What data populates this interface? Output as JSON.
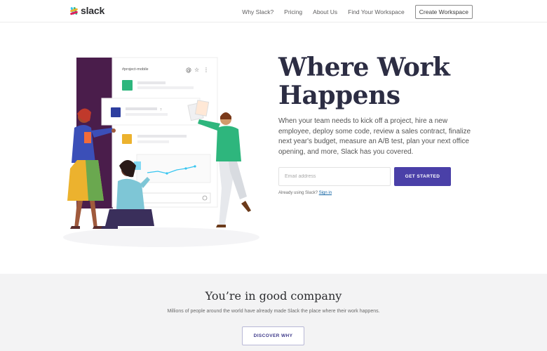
{
  "header": {
    "brand": "slack",
    "nav": [
      "Why Slack?",
      "Pricing",
      "About Us",
      "Find Your Workspace"
    ],
    "cta": "Create Workspace"
  },
  "hero": {
    "title_line1": "Where Work",
    "title_line2": "Happens",
    "description": "When your team needs to kick off a project, hire a new employee, deploy some code, review a sales contract, finalize next year's budget, measure an A/B test, plan your next office opening, and more, Slack has you covered.",
    "email_placeholder": "Email address",
    "email_value": "",
    "get_started": "GET STARTED",
    "already_text": "Already using Slack?",
    "sign_in": "Sign in"
  },
  "illustration": {
    "channel": "#project-mobile",
    "colors": {
      "purple": "#4a1d4b",
      "teal": "#2eb67d",
      "blue": "#2d3e9f",
      "yellow": "#ecb22e",
      "orange": "#f26b3a"
    }
  },
  "company": {
    "title": "You’re in good company",
    "subtitle": "Millions of people around the world have already made Slack the place where their work happens.",
    "button": "DISCOVER WHY"
  }
}
